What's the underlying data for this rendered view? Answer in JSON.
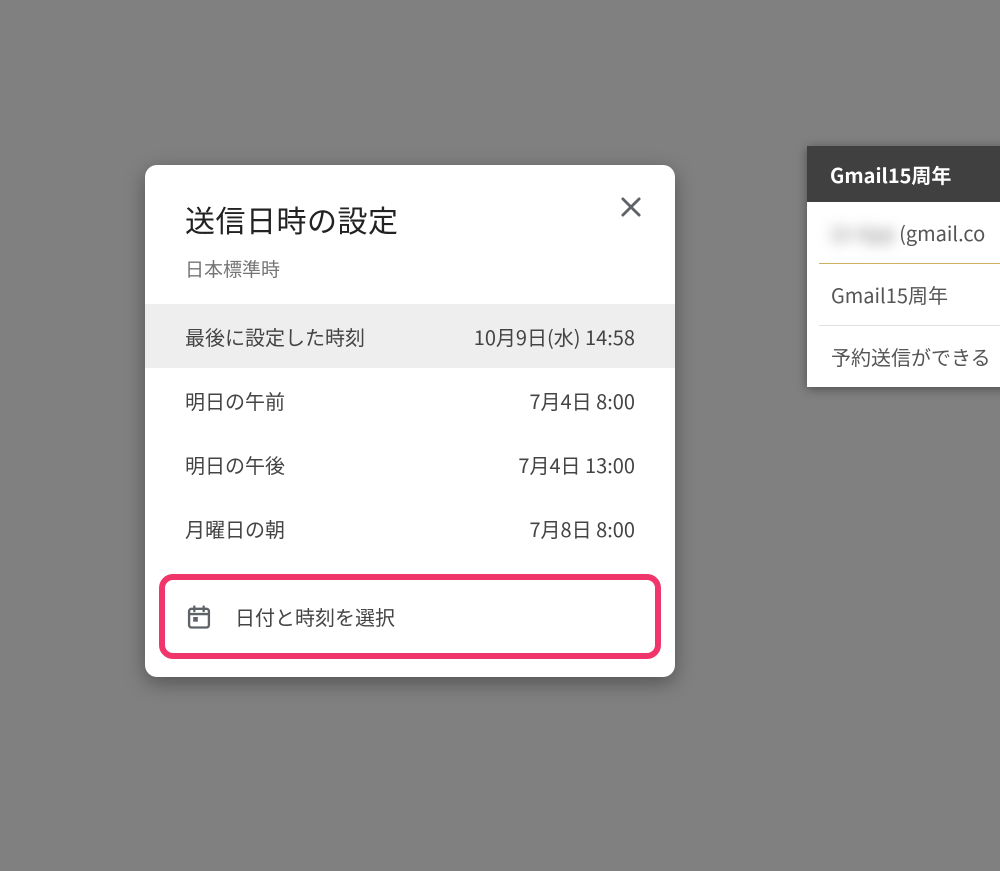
{
  "compose": {
    "header": "Gmail15周年",
    "recipient_blurred": "Ur App",
    "recipient_suffix": " (gmail.co",
    "subject": "Gmail15周年",
    "body_preview": "予約送信ができる"
  },
  "dialog": {
    "title": "送信日時の設定",
    "subtitle": "日本標準時",
    "options": [
      {
        "label": "最後に設定した時刻",
        "time": "10月9日(水) 14:58",
        "selected": true
      },
      {
        "label": "明日の午前",
        "time": "7月4日 8:00",
        "selected": false
      },
      {
        "label": "明日の午後",
        "time": "7月4日 13:00",
        "selected": false
      },
      {
        "label": "月曜日の朝",
        "time": "7月8日 8:00",
        "selected": false
      }
    ],
    "picker_label": "日付と時刻を選択"
  }
}
